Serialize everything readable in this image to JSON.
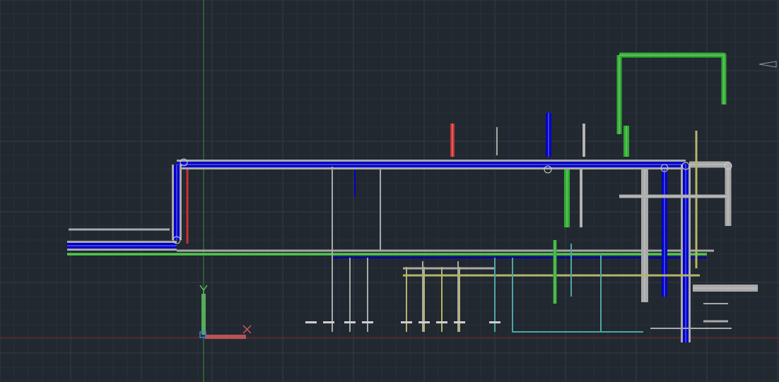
{
  "drawing": {
    "colors": {
      "background": "#212830",
      "grid_minor": "#2a313b",
      "grid_major": "#343c48",
      "pipe_gray": "#a9a9a9",
      "pipe_blue": "#0000cc",
      "pipe_green": "#2fae2f",
      "pipe_red": "#c83232",
      "pipe_olive": "#b5b56a",
      "pipe_teal": "#4fa6a6",
      "y_axis_line": "#3f8a3f",
      "x_axis_line": "#7a2a2a"
    }
  },
  "ucs_icon": {
    "x_label": "X",
    "y_label": "Y",
    "x_color": "#cf5a5a",
    "y_color": "#5fbf5f"
  },
  "viewcube_hint": "nav-arrow-icon"
}
